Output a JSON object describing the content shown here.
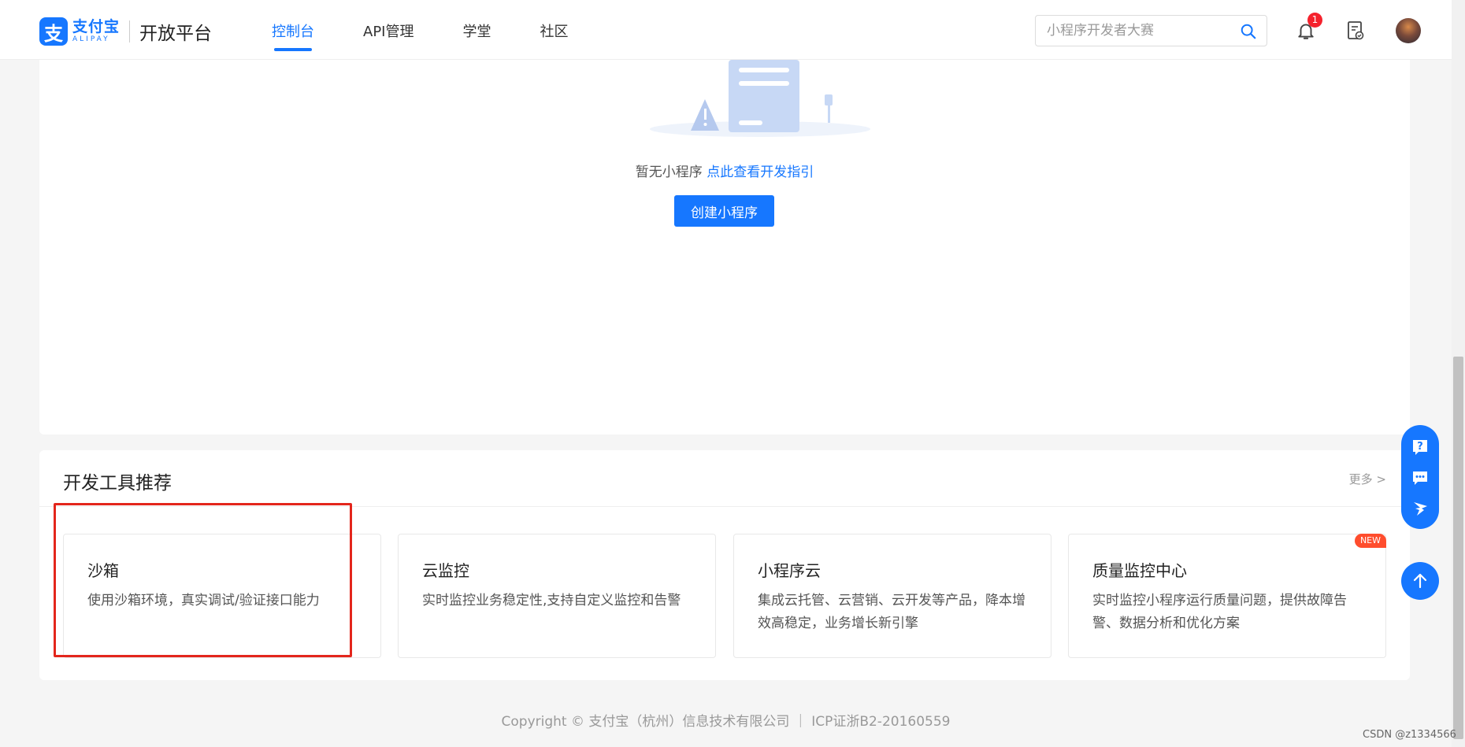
{
  "header": {
    "logo_cn": "支付宝",
    "logo_en": "ALIPAY",
    "platform": "开放平台",
    "nav": [
      "控制台",
      "API管理",
      "学堂",
      "社区"
    ],
    "active_nav": "控制台",
    "search_placeholder": "小程序开发者大赛",
    "notification_count": "1"
  },
  "empty_state": {
    "text": "暂无小程序",
    "link": "点此查看开发指引",
    "create_button": "创建小程序"
  },
  "tools": {
    "title": "开发工具推荐",
    "more": "更多 >",
    "cards": [
      {
        "name": "沙箱",
        "desc": "使用沙箱环境，真实调试/验证接口能力",
        "tag": ""
      },
      {
        "name": "云监控",
        "desc": "实时监控业务稳定性,支持自定义监控和告警",
        "tag": ""
      },
      {
        "name": "小程序云",
        "desc": "集成云托管、云营销、云开发等产品，降本增效高稳定，业务增长新引擎",
        "tag": ""
      },
      {
        "name": "质量监控中心",
        "desc": "实时监控小程序运行质量问题，提供故障告警、数据分析和优化方案",
        "tag": "NEW"
      }
    ]
  },
  "footer": "Copyright © 支付宝（杭州）信息技术有限公司 ｜ ICP证浙B2-20160559",
  "watermark": "CSDN @z1334566",
  "colors": {
    "primary": "#1677ff",
    "highlight": "#e3261c",
    "badge": "#f5222d"
  }
}
